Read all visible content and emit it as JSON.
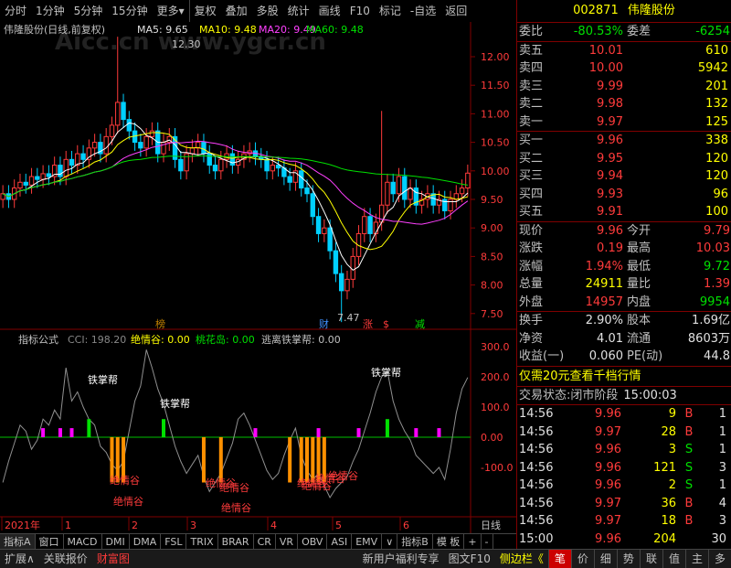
{
  "toolbar": [
    "分时",
    "1分钟",
    "5分钟",
    "15分钟",
    "更多▾",
    "复权",
    "叠加",
    "多股",
    "统计",
    "画线",
    "F10",
    "标记",
    "-自选",
    "返回"
  ],
  "watermark": "Aicc.cn  www.ygcr.cn",
  "kline_header": {
    "title": "伟隆股份(日线,前复权)",
    "ma5": "MA5: 9.65",
    "ma10": "MA10: 9.48",
    "ma20": "MA20: 9.49",
    "ma60": "MA60: 9.48"
  },
  "price_axis": [
    "12.00",
    "11.50",
    "11.00",
    "10.50",
    "10.00",
    "9.50",
    "9.00",
    "8.50",
    "8.00",
    "7.50"
  ],
  "annotations": {
    "high": "12.30",
    "low": "7.47",
    "markers": [
      "榜",
      "财",
      "涨",
      "$",
      "减"
    ]
  },
  "indicator_header": {
    "label": "指标公式",
    "cci": "CCI: 198.20",
    "jqg": "绝情谷: 0.00",
    "thd": "桃花岛: 0.00",
    "tlz": "逃离铁掌帮: 0.00"
  },
  "ind_axis": [
    "300.0",
    "200.0",
    "100.0",
    "0.00",
    "-100.0"
  ],
  "ind_labels": {
    "tzb": "铁掌帮",
    "jqg": "绝情谷"
  },
  "date_axis": [
    "2021年",
    "1",
    "2",
    "3",
    "4",
    "5",
    "6"
  ],
  "date_right": "日线",
  "tabs": [
    "指标A",
    "窗口",
    "MACD",
    "DMI",
    "DMA",
    "FSL",
    "TRIX",
    "BRAR",
    "CR",
    "VR",
    "OBV",
    "ASI",
    "EMV",
    "∨",
    "指标B",
    "模 板",
    "+",
    "-"
  ],
  "stock": {
    "code": "002871",
    "name": "伟隆股份"
  },
  "ratio": {
    "wb_label": "委比",
    "wb": "-80.53%",
    "wc_label": "委差",
    "wc": "-6254"
  },
  "asks": [
    {
      "label": "卖五",
      "price": "10.01",
      "vol": "610"
    },
    {
      "label": "卖四",
      "price": "10.00",
      "vol": "5942"
    },
    {
      "label": "卖三",
      "price": "9.99",
      "vol": "201"
    },
    {
      "label": "卖二",
      "price": "9.98",
      "vol": "132"
    },
    {
      "label": "卖一",
      "price": "9.97",
      "vol": "125"
    }
  ],
  "bids": [
    {
      "label": "买一",
      "price": "9.96",
      "vol": "338"
    },
    {
      "label": "买二",
      "price": "9.95",
      "vol": "120"
    },
    {
      "label": "买三",
      "price": "9.94",
      "vol": "120"
    },
    {
      "label": "买四",
      "price": "9.93",
      "vol": "96"
    },
    {
      "label": "买五",
      "price": "9.91",
      "vol": "100"
    }
  ],
  "quote": [
    {
      "l1": "现价",
      "v1": "9.96",
      "c1": "red",
      "l2": "今开",
      "v2": "9.79",
      "c2": "red"
    },
    {
      "l1": "涨跌",
      "v1": "0.19",
      "c1": "red",
      "l2": "最高",
      "v2": "10.03",
      "c2": "red"
    },
    {
      "l1": "涨幅",
      "v1": "1.94%",
      "c1": "red",
      "l2": "最低",
      "v2": "9.72",
      "c2": "grn"
    },
    {
      "l1": "总量",
      "v1": "24911",
      "c1": "yel",
      "l2": "量比",
      "v2": "1.39",
      "c2": "red"
    },
    {
      "l1": "外盘",
      "v1": "14957",
      "c1": "red",
      "l2": "内盘",
      "v2": "9954",
      "c2": "grn"
    }
  ],
  "stats": [
    {
      "l1": "换手",
      "v1": "2.90%",
      "l2": "股本",
      "v2": "1.69亿"
    },
    {
      "l1": "净资",
      "v1": "4.01",
      "l2": "流通",
      "v2": "8603万"
    },
    {
      "l1": "收益(一)",
      "v1": "0.060",
      "l2": "PE(动)",
      "v2": "44.8"
    }
  ],
  "promo": "仅需20元查看千档行情",
  "trade_state": {
    "label": "交易状态:",
    "state": "闭市阶段",
    "time": "15:00:03"
  },
  "ticks": [
    {
      "t": "14:56",
      "p": "9.96",
      "v": "9",
      "s": "B",
      "sc": "red",
      "n": "1"
    },
    {
      "t": "14:56",
      "p": "9.97",
      "v": "28",
      "s": "B",
      "sc": "red",
      "n": "1"
    },
    {
      "t": "14:56",
      "p": "9.96",
      "v": "3",
      "s": "S",
      "sc": "grn",
      "n": "1"
    },
    {
      "t": "14:56",
      "p": "9.96",
      "v": "121",
      "s": "S",
      "sc": "grn",
      "n": "3"
    },
    {
      "t": "14:56",
      "p": "9.96",
      "v": "2",
      "s": "S",
      "sc": "grn",
      "n": "1"
    },
    {
      "t": "14:56",
      "p": "9.97",
      "v": "36",
      "s": "B",
      "sc": "red",
      "n": "4"
    },
    {
      "t": "14:56",
      "p": "9.97",
      "v": "18",
      "s": "B",
      "sc": "red",
      "n": "3"
    },
    {
      "t": "15:00",
      "p": "9.96",
      "v": "204",
      "s": "",
      "sc": "red",
      "n": "30"
    }
  ],
  "bottom_left": [
    "扩展∧",
    "关联报价",
    "财富图"
  ],
  "bottom_mid": [
    "新用户福利专享",
    "图文F10",
    "侧边栏《"
  ],
  "bottom_right": [
    "笔",
    "价",
    "细",
    "势",
    "联",
    "值",
    "主",
    "多"
  ]
}
